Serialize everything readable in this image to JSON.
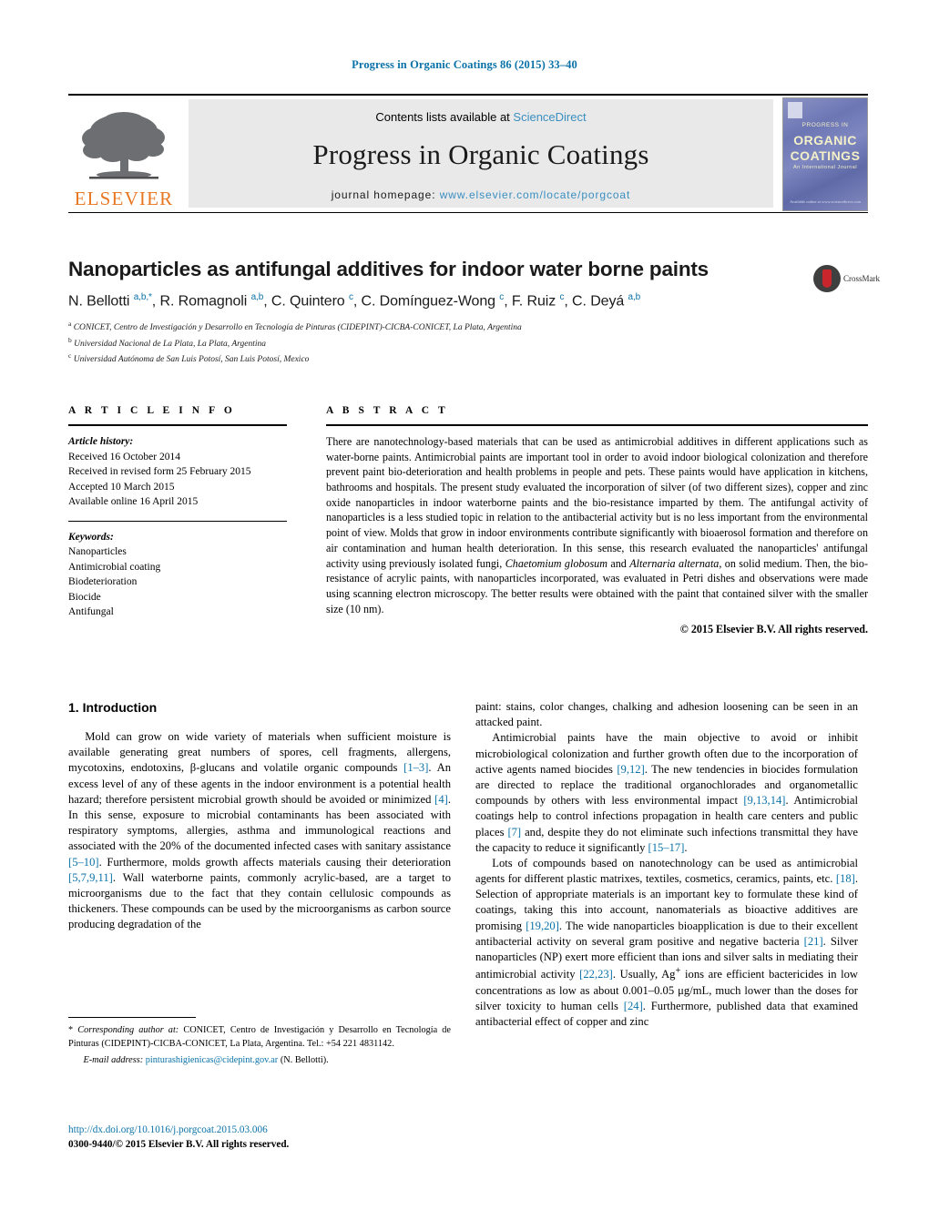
{
  "running_head": "Progress in Organic Coatings 86 (2015) 33–40",
  "masthead": {
    "contents_prefix": "Contents lists available at ",
    "contents_link": "ScienceDirect",
    "journal_title": "Progress in Organic Coatings",
    "homepage_label": "journal homepage: ",
    "homepage_url": "www.elsevier.com/locate/porgcoat",
    "publisher_logo_text": "ELSEVIER",
    "cover": {
      "line_small": "PROGRESS IN",
      "line_big_1": "ORGANIC",
      "line_big_2": "COATINGS",
      "line_sub": "An International Journal",
      "footer": "Available online at www.sciencedirect.com"
    }
  },
  "article": {
    "title": "Nanoparticles as antifungal additives for indoor water borne paints",
    "crossmark_label": "CrossMark",
    "authors_html": "N. Bellotti <sup>a,b,*</sup>, R. Romagnoli <sup>a,b</sup>, C. Quintero <sup>c</sup>, C. Domínguez-Wong <sup>c</sup>, F. Ruiz <sup>c</sup>, C. Deyá <sup>a,b</sup>",
    "affiliations": [
      "CONICET, Centro de Investigación y Desarrollo en Tecnología de Pinturas (CIDEPINT)-CICBA-CONICET, La Plata, Argentina",
      "Universidad Nacional de La Plata, La Plata, Argentina",
      "Universidad Autónoma de San Luis Potosí, San Luis Potosí, Mexico"
    ],
    "affiliation_marks": [
      "a",
      "b",
      "c"
    ]
  },
  "article_info": {
    "heading": "A R T I C L E   I N F O",
    "history_label": "Article history:",
    "history": [
      "Received 16 October 2014",
      "Received in revised form 25 February 2015",
      "Accepted 10 March 2015",
      "Available online 16 April 2015"
    ],
    "keywords_label": "Keywords:",
    "keywords": [
      "Nanoparticles",
      "Antimicrobial coating",
      "Biodeterioration",
      "Biocide",
      "Antifungal"
    ]
  },
  "abstract": {
    "heading": "A B S T R A C T",
    "text_html": "There are nanotechnology-based materials that can be used as antimicrobial additives in different applications such as water-borne paints. Antimicrobial paints are important tool in order to avoid indoor biological colonization and therefore prevent paint bio-deterioration and health problems in people and pets. These paints would have application in kitchens, bathrooms and hospitals. The present study evaluated the incorporation of silver (of two different sizes), copper and zinc oxide nanoparticles in indoor waterborne paints and the bio-resistance imparted by them. The antifungal activity of nanoparticles is a less studied topic in relation to the antibacterial activity but is no less important from the environmental point of view. Molds that grow in indoor environments contribute significantly with bioaerosol formation and therefore on air contamination and human health deterioration. In this sense, this research evaluated the nanoparticles' antifungal activity using previously isolated fungi, <em>Chaetomium globosum</em> and <em>Alternaria alternata</em>, on solid medium. Then, the bio-resistance of acrylic paints, with nanoparticles incorporated, was evaluated in Petri dishes and observations were made using scanning electron microscopy. The better results were obtained with the paint that contained silver with the smaller size (10 nm).",
    "copyright": "© 2015 Elsevier B.V. All rights reserved."
  },
  "body": {
    "section_heading": "1.  Introduction",
    "left_paragraphs_html": [
      "Mold can grow on wide variety of materials when sufficient moisture is available generating great numbers of spores, cell fragments, allergens, mycotoxins, endotoxins, β-glucans and volatile organic compounds <span class=\"ref\">[1–3]</span>. An excess level of any of these agents in the indoor environment is a potential health hazard; therefore persistent microbial growth should be avoided or minimized <span class=\"ref\">[4]</span>. In this sense, exposure to microbial contaminants has been associated with respiratory symptoms, allergies, asthma and immunological reactions and associated with the 20% of the documented infected cases with sanitary assistance <span class=\"ref\">[5–10]</span>. Furthermore, molds growth affects materials causing their deterioration <span class=\"ref\">[5,7,9,11]</span>. Wall waterborne paints, commonly acrylic-based, are a target to microorganisms due to the fact that they contain cellulosic compounds as thickeners. These compounds can be used by the microorganisms as carbon source producing degradation of the"
    ],
    "right_paragraphs_html": [
      "paint: stains, color changes, chalking and adhesion loosening can be seen in an attacked paint.",
      "Antimicrobial paints have the main objective to avoid or inhibit microbiological colonization and further growth often due to the incorporation of active agents named biocides <span class=\"ref\">[9,12]</span>. The new tendencies in biocides formulation are directed to replace the traditional organochlorades and organometallic compounds by others with less environmental impact <span class=\"ref\">[9,13,14]</span>. Antimicrobial coatings help to control infections propagation in health care centers and public places <span class=\"ref\">[7]</span> and, despite they do not eliminate such infections transmittal they have the capacity to reduce it significantly <span class=\"ref\">[15–17]</span>.",
      "Lots of compounds based on nanotechnology can be used as antimicrobial agents for different plastic matrixes, textiles, cosmetics, ceramics, paints, etc. <span class=\"ref\">[18]</span>. Selection of appropriate materials is an important key to formulate these kind of coatings, taking this into account, nanomaterials as bioactive additives are promising <span class=\"ref\">[19,20]</span>. The wide nanoparticles bioapplication is due to their excellent antibacterial activity on several gram positive and negative bacteria <span class=\"ref\">[21]</span>. Silver nanoparticles (NP) exert more efficient than ions and silver salts in mediating their antimicrobial activity <span class=\"ref\">[22,23]</span>. Usually, Ag<sup>+</sup> ions are efficient bactericides in low concentrations as low as about 0.001–0.05 μg/mL, much lower than the doses for silver toxicity to human cells <span class=\"ref\">[24]</span>. Furthermore, published data that examined antibacterial effect of copper and zinc"
    ]
  },
  "footnotes": {
    "corresponding_html": "* <span class=\"ital\">Corresponding author at:</span> CONICET, Centro de Investigación y Desarrollo en Tecnología de Pinturas (CIDEPINT)-CICBA-CONICET, La Plata, Argentina. Tel.: +54 221 4831142.",
    "email_label": "E-mail address:",
    "email": "pinturashigienicas@cidepint.gov.ar",
    "email_suffix": "(N. Bellotti).",
    "doi_url": "http://dx.doi.org/10.1016/j.porgcoat.2015.03.006",
    "issn_line": "0300-9440/© 2015 Elsevier B.V. All rights reserved."
  }
}
